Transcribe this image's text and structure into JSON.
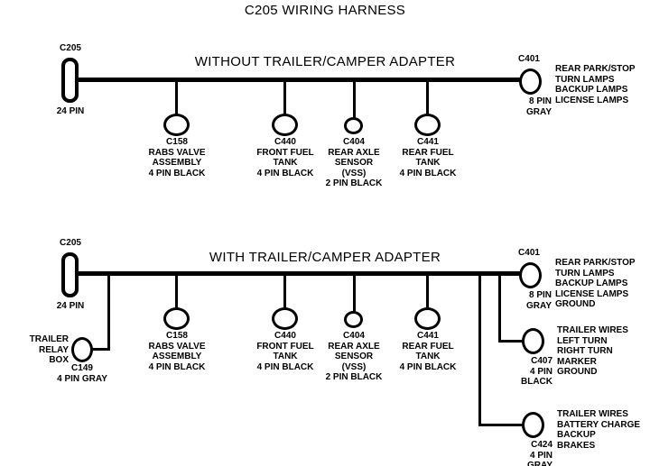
{
  "diagram": {
    "title": "C205 WIRING HARNESS"
  },
  "sections": [
    {
      "heading": "WITHOUT  TRAILER/CAMPER  ADAPTER",
      "source_connector": {
        "id": "C205",
        "pins": "24 PIN"
      },
      "end_connector": {
        "id": "C401",
        "pins": "8 PIN",
        "color": "GRAY",
        "functions": [
          "REAR PARK/STOP",
          "TURN LAMPS",
          "BACKUP LAMPS",
          "LICENSE LAMPS"
        ]
      },
      "branches": [
        {
          "id": "C158",
          "name_lines": [
            "RABS VALVE",
            "ASSEMBLY"
          ],
          "spec": "4 PIN BLACK"
        },
        {
          "id": "C440",
          "name_lines": [
            "FRONT FUEL",
            "TANK"
          ],
          "spec": "4 PIN BLACK"
        },
        {
          "id": "C404",
          "name_lines": [
            "REAR AXLE",
            "SENSOR",
            "(VSS)"
          ],
          "spec": "2 PIN BLACK"
        },
        {
          "id": "C441",
          "name_lines": [
            "REAR FUEL",
            "TANK"
          ],
          "spec": "4 PIN BLACK"
        }
      ]
    },
    {
      "heading": "WITH TRAILER/CAMPER  ADAPTER",
      "source_connector": {
        "id": "C205",
        "pins": "24 PIN"
      },
      "end_connector": {
        "id": "C401",
        "pins": "8 PIN",
        "color": "GRAY",
        "functions": [
          "REAR PARK/STOP",
          "TURN LAMPS",
          "BACKUP LAMPS",
          "LICENSE LAMPS",
          "GROUND"
        ]
      },
      "branches": [
        {
          "id": "C158",
          "name_lines": [
            "RABS VALVE",
            "ASSEMBLY"
          ],
          "spec": "4 PIN BLACK"
        },
        {
          "id": "C440",
          "name_lines": [
            "FRONT FUEL",
            "TANK"
          ],
          "spec": "4 PIN BLACK"
        },
        {
          "id": "C404",
          "name_lines": [
            "REAR AXLE",
            "SENSOR",
            "(VSS)"
          ],
          "spec": "2 PIN BLACK"
        },
        {
          "id": "C441",
          "name_lines": [
            "REAR FUEL",
            "TANK"
          ],
          "spec": "4 PIN BLACK"
        }
      ],
      "trailer_relay": {
        "name_lines": [
          "TRAILER",
          "RELAY",
          "BOX"
        ],
        "id": "C149",
        "spec": "4 PIN GRAY"
      },
      "lower_connectors": [
        {
          "id": "C407",
          "pins": "4 PIN",
          "color": "BLACK",
          "functions": [
            "TRAILER WIRES",
            " LEFT TURN",
            "RIGHT TURN",
            "MARKER",
            "GROUND"
          ]
        },
        {
          "id": "C424",
          "pins": "4 PIN",
          "color": "GRAY",
          "functions": [
            "TRAILER  WIRES",
            "BATTERY CHARGE",
            "BACKUP",
            "BRAKES"
          ]
        }
      ]
    }
  ]
}
